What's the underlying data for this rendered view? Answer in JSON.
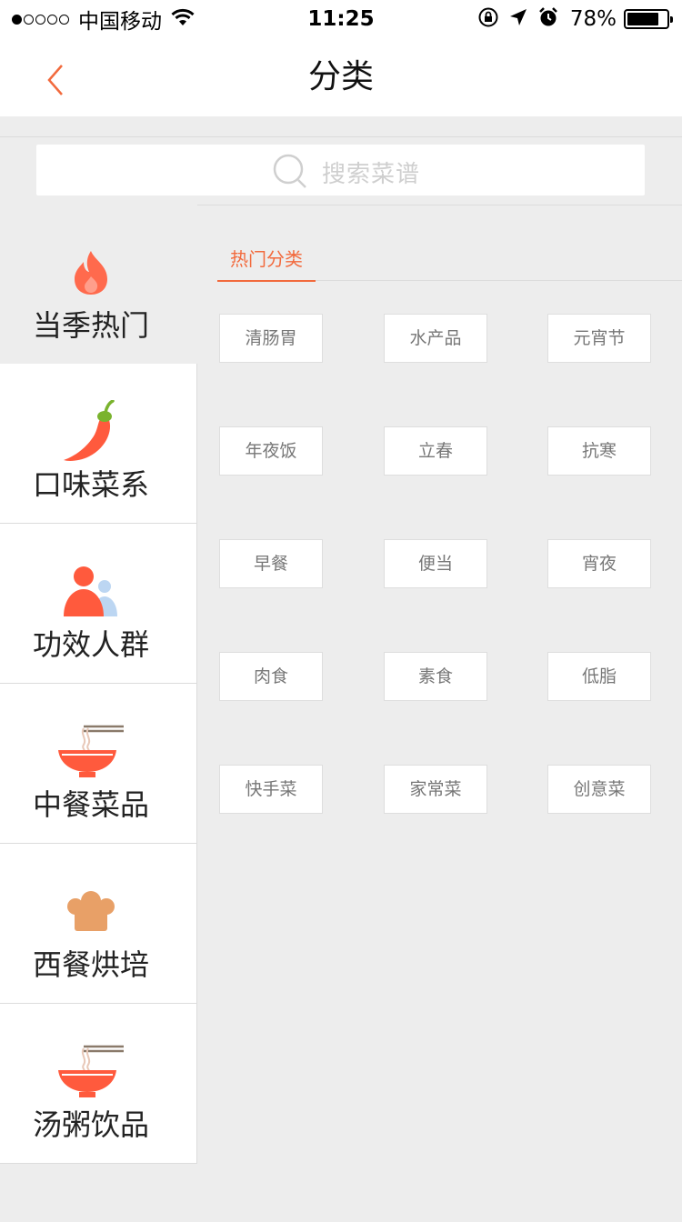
{
  "status_bar": {
    "carrier": "中国移动",
    "time": "11:25",
    "battery_percent": "78%",
    "battery_level": 0.78,
    "signal_dots_filled": 1,
    "signal_dots_total": 5
  },
  "nav": {
    "title": "分类",
    "back_icon": "chevron-left-icon",
    "accent_color": "#f26a3d"
  },
  "search": {
    "placeholder": "搜索菜谱",
    "icon": "search-icon"
  },
  "sidebar": {
    "items": [
      {
        "label": "当季热门",
        "icon": "flame-icon",
        "active": true
      },
      {
        "label": "口味菜系",
        "icon": "chili-pepper-icon",
        "active": false
      },
      {
        "label": "功效人群",
        "icon": "people-icon",
        "active": false
      },
      {
        "label": "中餐菜品",
        "icon": "noodle-bowl-icon",
        "active": false
      },
      {
        "label": "西餐烘培",
        "icon": "chef-hat-icon",
        "active": false
      },
      {
        "label": "汤粥饮品",
        "icon": "soup-bowl-icon",
        "active": false
      }
    ]
  },
  "content": {
    "tab_label": "热门分类",
    "tags": [
      [
        "清肠胃",
        "水产品",
        "元宵节"
      ],
      [
        "年夜饭",
        "立春",
        "抗寒"
      ],
      [
        "早餐",
        "便当",
        "宵夜"
      ],
      [
        "肉食",
        "素食",
        "低脂"
      ],
      [
        "快手菜",
        "家常菜",
        "创意菜"
      ]
    ]
  }
}
